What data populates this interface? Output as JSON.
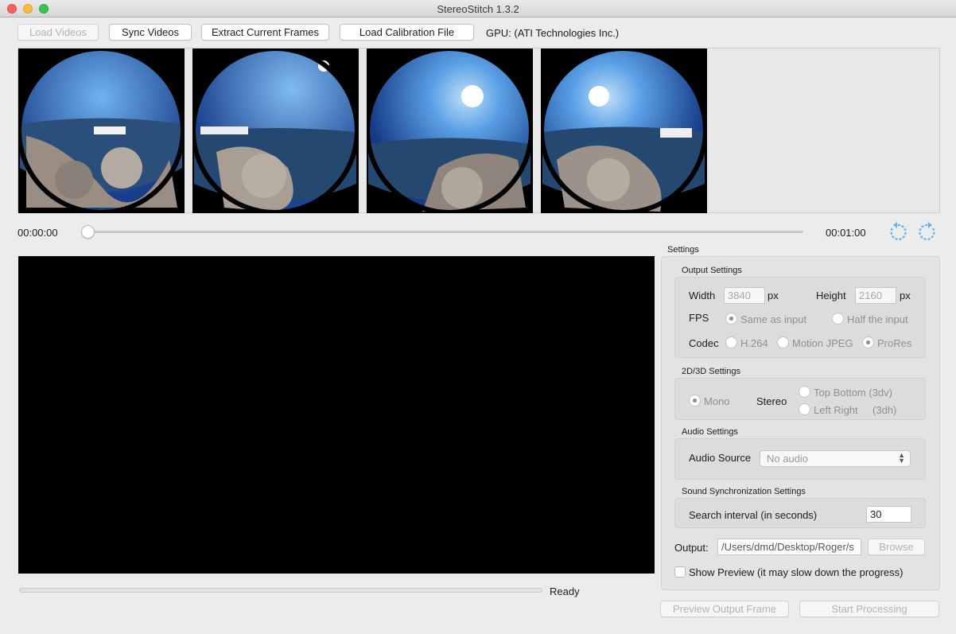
{
  "window": {
    "title": "StereoStitch 1.3.2"
  },
  "toolbar": {
    "load_videos": "Load Videos",
    "sync_videos": "Sync Videos",
    "extract_frames": "Extract Current Frames",
    "load_calibration": "Load Calibration File",
    "gpu": "GPU: (ATI Technologies Inc.)"
  },
  "timeline": {
    "start": "00:00:00",
    "end": "00:01:00",
    "position_fraction": 0.0
  },
  "status": {
    "text": "Ready",
    "progress_fraction": 0.0
  },
  "settings": {
    "title": "Settings",
    "output": {
      "title": "Output Settings",
      "width_label": "Width",
      "width_value": "3840",
      "width_unit": "px",
      "height_label": "Height",
      "height_value": "2160",
      "height_unit": "px",
      "fps_label": "FPS",
      "fps_same": "Same as input",
      "fps_half": "Half the input",
      "codec_label": "Codec",
      "codec_h264": "H.264",
      "codec_mjpeg": "Motion JPEG",
      "codec_prores": "ProRes"
    },
    "dim": {
      "title": "2D/3D Settings",
      "mono": "Mono",
      "stereo_label": "Stereo",
      "top_bottom": "Top Bottom (3dv)",
      "left_right": "Left Right",
      "left_right_suffix": "(3dh)"
    },
    "audio": {
      "title": "Audio Settings",
      "source_label": "Audio Source",
      "source_value": "No audio"
    },
    "sync": {
      "title": "Sound Synchronization Settings",
      "interval_label": "Search interval (in seconds)",
      "interval_value": "30"
    },
    "output_path": {
      "label": "Output:",
      "value": "/Users/dmd/Desktop/Roger/s",
      "browse": "Browse"
    },
    "show_preview": "Show Preview (it may slow down the progress)"
  },
  "actions": {
    "preview_frame": "Preview Output Frame",
    "start": "Start Processing"
  },
  "colors": {
    "accent_icon": "#5ab4f0"
  }
}
